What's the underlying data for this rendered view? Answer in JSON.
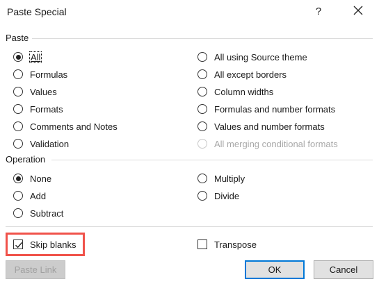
{
  "dialog": {
    "title": "Paste Special",
    "help": "?"
  },
  "paste": {
    "label": "Paste",
    "left": [
      {
        "label": "All",
        "checked": true
      },
      {
        "label": "Formulas"
      },
      {
        "label": "Values"
      },
      {
        "label": "Formats"
      },
      {
        "label": "Comments and Notes"
      },
      {
        "label": "Validation"
      }
    ],
    "right": [
      {
        "label": "All using Source theme"
      },
      {
        "label": "All except borders"
      },
      {
        "label": "Column widths"
      },
      {
        "label": "Formulas and number formats"
      },
      {
        "label": "Values and number formats"
      },
      {
        "label": "All merging conditional formats",
        "disabled": true
      }
    ]
  },
  "operation": {
    "label": "Operation",
    "left": [
      {
        "label": "None",
        "checked": true
      },
      {
        "label": "Add"
      },
      {
        "label": "Subtract"
      }
    ],
    "right": [
      {
        "label": "Multiply"
      },
      {
        "label": "Divide"
      }
    ]
  },
  "options": {
    "skip_blanks": {
      "label": "Skip blanks",
      "checked": true
    },
    "transpose": {
      "label": "Transpose",
      "checked": false
    }
  },
  "buttons": {
    "paste_link": "Paste Link",
    "ok": "OK",
    "cancel": "Cancel"
  }
}
